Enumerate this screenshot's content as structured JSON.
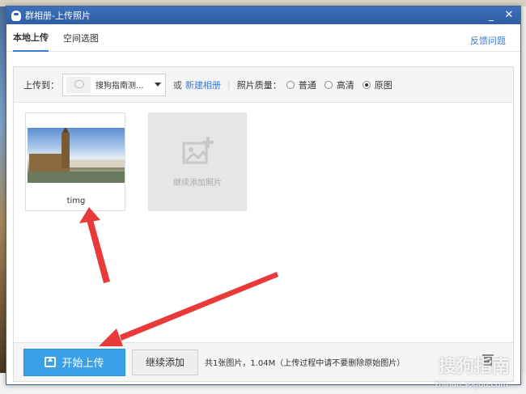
{
  "window": {
    "title": "群相册-上传照片",
    "minimize_glyph": "_",
    "close_glyph": "✕"
  },
  "tabs": [
    {
      "label": "本地上传",
      "active": true
    },
    {
      "label": "空间选图",
      "active": false
    }
  ],
  "feedback_label": "反馈问题",
  "toolbar": {
    "upload_to_label": "上传到：",
    "album_name": "搜狗指南测...",
    "or_label": "或",
    "new_album_label": "新建相册",
    "separator": "|",
    "quality_label": "照片质量：",
    "quality_options": [
      {
        "label": "普通",
        "checked": false
      },
      {
        "label": "高清",
        "checked": false
      },
      {
        "label": "原图",
        "checked": true
      }
    ]
  },
  "photos": [
    {
      "name": "timg"
    }
  ],
  "add_more_label": "继续添加照片",
  "footer": {
    "start_label": "开始上传",
    "continue_label": "继续添加",
    "summary": "共1张图片，1.04M（上传过程中请不要删除原始图片）"
  },
  "watermark": {
    "text": "搜狗指南",
    "url": "zhinan.sogou.com"
  },
  "colors": {
    "titlebar": "#2f5ea6",
    "accent": "#3a7bd5",
    "start_button": "#3aa0e8",
    "arrow": "#e83a3a"
  },
  "icons": {
    "app": "qq-penguin-icon",
    "trash": "trash-icon",
    "upload": "upload-icon",
    "add_photo": "add-photo-icon"
  }
}
